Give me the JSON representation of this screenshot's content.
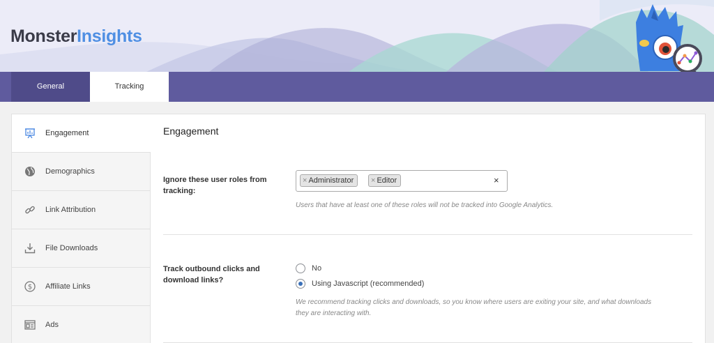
{
  "brand": {
    "part1": "Monster",
    "part2": "Insights"
  },
  "tabs": [
    {
      "label": "General",
      "active": false
    },
    {
      "label": "Tracking",
      "active": true
    }
  ],
  "sidebar": {
    "items": [
      {
        "label": "Engagement",
        "icon": "presentation-chart-icon",
        "active": true
      },
      {
        "label": "Demographics",
        "icon": "globe-icon",
        "active": false
      },
      {
        "label": "Link Attribution",
        "icon": "link-icon",
        "active": false
      },
      {
        "label": "File Downloads",
        "icon": "download-icon",
        "active": false
      },
      {
        "label": "Affiliate Links",
        "icon": "dollar-icon",
        "active": false
      },
      {
        "label": "Ads",
        "icon": "ads-layout-icon",
        "active": false
      }
    ]
  },
  "main": {
    "section_title": "Engagement",
    "ignore_roles": {
      "label_line1": "Ignore these user roles from",
      "label_line2": "tracking:",
      "selected": [
        "Administrator",
        "Editor"
      ],
      "chip_remove": "×",
      "clear": "×",
      "help": "Users that have at least one of these roles will not be tracked into Google Analytics."
    },
    "outbound": {
      "label_line1": "Track outbound clicks and",
      "label_line2": "download links?",
      "options": [
        {
          "label": "No",
          "checked": false
        },
        {
          "label": "Using Javascript (recommended)",
          "checked": true
        }
      ],
      "help_line1": "We recommend tracking clicks and downloads, so you know where users are exiting your site, and what downloads",
      "help_line2": "they are interacting with."
    }
  },
  "colors": {
    "tabbar": "#5f5b9e",
    "tab_dark": "#4f4b89",
    "brand_dark": "#3a3b48",
    "brand_blue": "#4f8fe3",
    "mascot_blue": "#3d7fe0",
    "radio_checked": "#3a70b8"
  }
}
